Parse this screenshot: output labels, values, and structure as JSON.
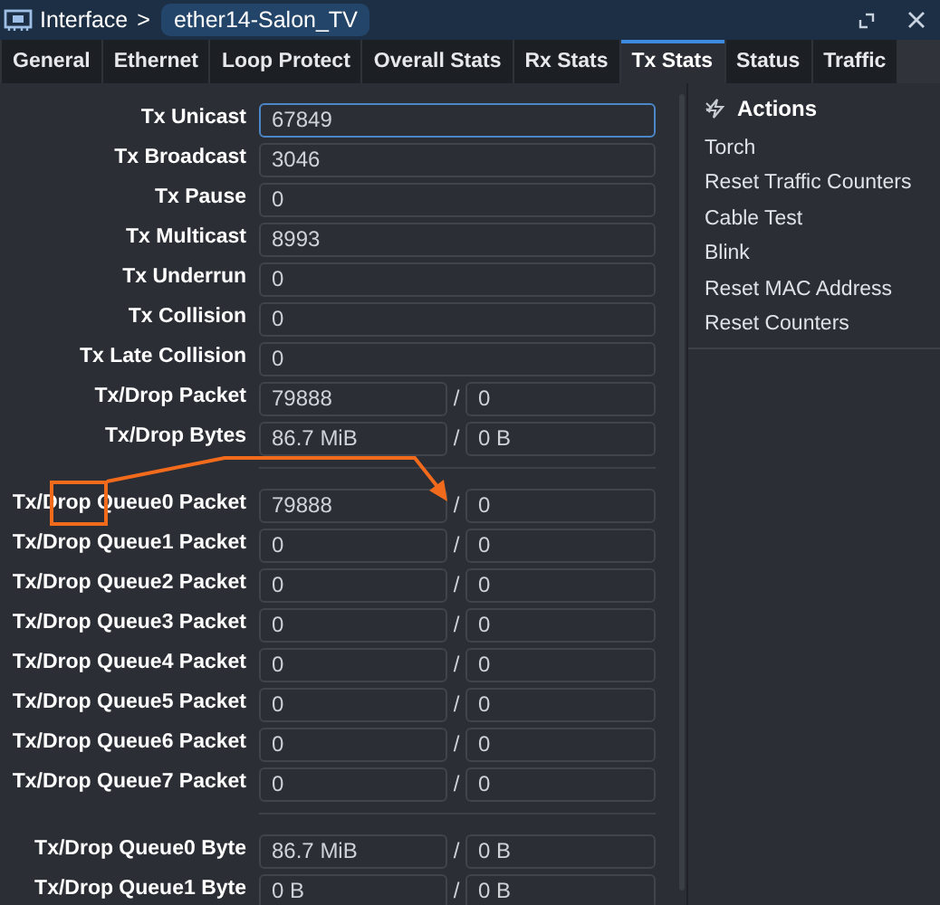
{
  "window": {
    "section": "Interface",
    "separator": ">",
    "name": "ether14-Salon_TV"
  },
  "tabs": [
    {
      "label": "General",
      "selected": false
    },
    {
      "label": "Ethernet",
      "selected": false
    },
    {
      "label": "Loop Protect",
      "selected": false
    },
    {
      "label": "Overall Stats",
      "selected": false
    },
    {
      "label": "Rx Stats",
      "selected": false
    },
    {
      "label": "Tx Stats",
      "selected": true
    },
    {
      "label": "Status",
      "selected": false
    },
    {
      "label": "Traffic",
      "selected": false
    }
  ],
  "groups": [
    [
      {
        "label": "Tx Unicast",
        "kind": "single",
        "values": [
          "67849"
        ],
        "focused": true
      },
      {
        "label": "Tx Broadcast",
        "kind": "single",
        "values": [
          "3046"
        ],
        "focused": false
      },
      {
        "label": "Tx Pause",
        "kind": "single",
        "values": [
          "0"
        ],
        "focused": false
      },
      {
        "label": "Tx Multicast",
        "kind": "single",
        "values": [
          "8993"
        ],
        "focused": false
      },
      {
        "label": "Tx Underrun",
        "kind": "single",
        "values": [
          "0"
        ],
        "focused": false
      },
      {
        "label": "Tx Collision",
        "kind": "single",
        "values": [
          "0"
        ],
        "focused": false
      },
      {
        "label": "Tx Late Collision",
        "kind": "single",
        "values": [
          "0"
        ],
        "focused": false
      },
      {
        "label": "Tx/Drop Packet",
        "kind": "pair",
        "values": [
          "79888",
          "0"
        ],
        "separator": "/",
        "focused": false
      },
      {
        "label": "Tx/Drop Bytes",
        "kind": "pair",
        "values": [
          "86.7 MiB",
          "0 B"
        ],
        "separator": "/",
        "focused": false
      }
    ],
    [
      {
        "label": "Tx/Drop Queue0 Packet",
        "kind": "pair",
        "values": [
          "79888",
          "0"
        ],
        "separator": "/",
        "focused": false
      },
      {
        "label": "Tx/Drop Queue1 Packet",
        "kind": "pair",
        "values": [
          "0",
          "0"
        ],
        "separator": "/",
        "focused": false
      },
      {
        "label": "Tx/Drop Queue2 Packet",
        "kind": "pair",
        "values": [
          "0",
          "0"
        ],
        "separator": "/",
        "focused": false
      },
      {
        "label": "Tx/Drop Queue3 Packet",
        "kind": "pair",
        "values": [
          "0",
          "0"
        ],
        "separator": "/",
        "focused": false
      },
      {
        "label": "Tx/Drop Queue4 Packet",
        "kind": "pair",
        "values": [
          "0",
          "0"
        ],
        "separator": "/",
        "focused": false
      },
      {
        "label": "Tx/Drop Queue5 Packet",
        "kind": "pair",
        "values": [
          "0",
          "0"
        ],
        "separator": "/",
        "focused": false
      },
      {
        "label": "Tx/Drop Queue6 Packet",
        "kind": "pair",
        "values": [
          "0",
          "0"
        ],
        "separator": "/",
        "focused": false
      },
      {
        "label": "Tx/Drop Queue7 Packet",
        "kind": "pair",
        "values": [
          "0",
          "0"
        ],
        "separator": "/",
        "focused": false
      }
    ],
    [
      {
        "label": "Tx/Drop Queue0 Byte",
        "kind": "pair",
        "values": [
          "86.7 MiB",
          "0 B"
        ],
        "separator": "/",
        "focused": false
      },
      {
        "label": "Tx/Drop Queue1 Byte",
        "kind": "pair",
        "values": [
          "0 B",
          "0 B"
        ],
        "separator": "/",
        "focused": false
      }
    ]
  ],
  "actions": {
    "title": "Actions",
    "items": [
      "Torch",
      "Reset Traffic Counters",
      "Cable Test",
      "Blink",
      "Reset MAC Address",
      "Reset Counters"
    ]
  },
  "annotation": {
    "color": "#f26b1d"
  }
}
